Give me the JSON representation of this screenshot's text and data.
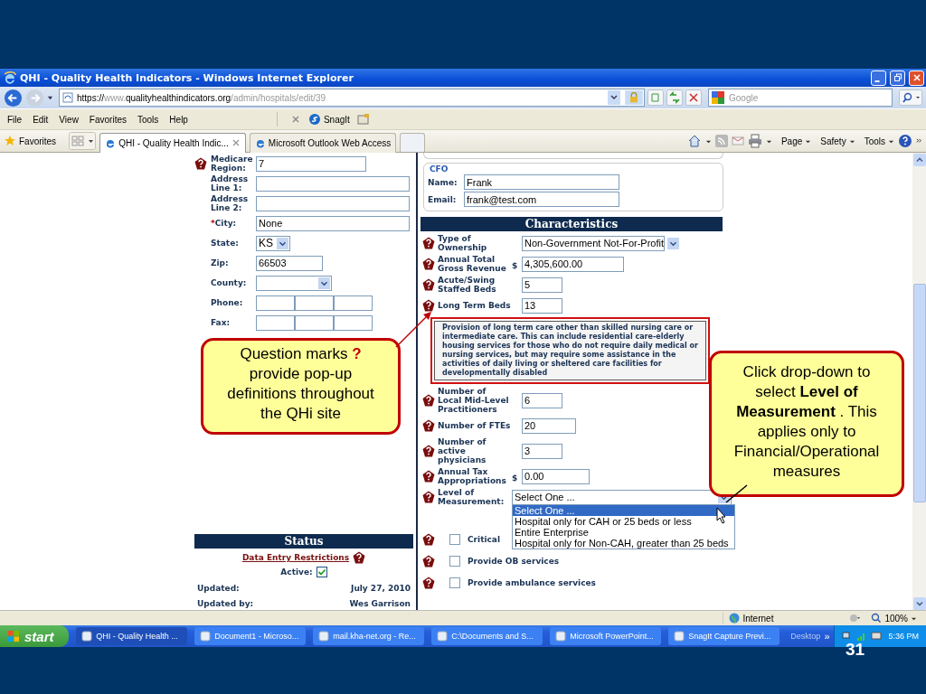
{
  "slide": {
    "number": "31"
  },
  "window": {
    "title": "QHI - Quality Health Indicators - Windows Internet Explorer"
  },
  "address_bar": {
    "url_parts": [
      {
        "text": "https://",
        "dim": false
      },
      {
        "text": "www.",
        "dim": true
      },
      {
        "text": "qualityhealthindicators.org",
        "dim": false
      },
      {
        "text": "/admin/hospitals/edit/39",
        "dim": true
      }
    ]
  },
  "search_field": {
    "placeholder": "Google"
  },
  "menu": [
    "File",
    "Edit",
    "View",
    "Favorites",
    "Tools",
    "Help"
  ],
  "snagit": "SnagIt",
  "favorites": "Favorites",
  "tabs": [
    {
      "label": "QHI - Quality Health Indic...",
      "selected": true
    },
    {
      "label": "Microsoft Outlook Web Access",
      "selected": false
    }
  ],
  "command_bar": [
    "Page",
    "Safety",
    "Tools"
  ],
  "left_form": {
    "rows": [
      {
        "label": "Medicare Region:",
        "help": true,
        "kind": "medium",
        "value": "7"
      },
      {
        "label": "Address Line 1:",
        "kind": "wide"
      },
      {
        "label": "Address Line 2:",
        "kind": "wide"
      },
      {
        "label": "City:",
        "required_mark": "*",
        "kind": "wide",
        "value": "None"
      },
      {
        "label": "State:",
        "kind": "select",
        "value": "KS"
      },
      {
        "label": "Zip:",
        "kind": "short",
        "value": "66503"
      },
      {
        "label": "County:",
        "kind": "combo"
      },
      {
        "label": "Phone:",
        "kind": "split"
      },
      {
        "label": "Fax:",
        "kind": "split"
      }
    ]
  },
  "status": {
    "title": "Status",
    "link": "Data Entry Restrictions",
    "active_label": "Active:",
    "active": true,
    "updated": [
      {
        "label": "Updated:",
        "value": "July 27, 2010"
      },
      {
        "label": "Updated by:",
        "value": "Wes Garrison"
      }
    ]
  },
  "cfo": {
    "legend": "CFO",
    "fields": [
      {
        "label": "Name:",
        "value": "Frank"
      },
      {
        "label": "Email:",
        "value": "frank@test.com"
      }
    ]
  },
  "characteristics": {
    "title": "Characteristics",
    "rows": [
      {
        "label": "Type of Ownership",
        "kind": "select",
        "value": "Non-Government Not-For-Profit"
      },
      {
        "label": "Annual Total Gross Revenue",
        "prefix": "$",
        "kind": "wide",
        "value": "4,305,600.00"
      },
      {
        "label": "Acute/Swing Staffed Beds",
        "kind": "short",
        "value": "5"
      },
      {
        "label": "Long Term Beds",
        "kind": "short",
        "value": "13",
        "tooltip": "Provision of long term care other than skilled nursing care or intermediate care. This can include residential care-elderly housing services for those who do not require daily medical or nursing services, but may require some assistance in the activities of daily living or sheltered care facilities for developmentally disabled"
      },
      {
        "label": "Number of Local Mid-Level Practitioners",
        "kind": "short",
        "value": "6"
      },
      {
        "label": "Number of FTEs",
        "kind": "medium",
        "value": "20"
      },
      {
        "label": "Number of active physicians",
        "kind": "short",
        "value": "3"
      },
      {
        "label": "Annual Tax Appropriations",
        "prefix": "$",
        "kind": "medium-wide",
        "value": "0.00"
      },
      {
        "label": "Level of Measurement:",
        "kind": "open-select",
        "value": "Select One ...",
        "options": [
          {
            "label": "Select One ...",
            "selected": true
          },
          {
            "label": "Hospital only for CAH or 25 beds or less",
            "selected": false
          },
          {
            "label": "Entire Enterprise",
            "selected": false
          },
          {
            "label": "Hospital only for Non-CAH, greater than 25 beds",
            "selected": false
          }
        ]
      }
    ],
    "checks": [
      {
        "label": "Critical",
        "checked": false
      },
      {
        "label": "Provide OB services",
        "checked": false
      },
      {
        "label": "Provide ambulance services",
        "checked": false
      }
    ]
  },
  "status_bar": {
    "zone": "Internet",
    "zoom": "100%"
  },
  "taskbar": {
    "start": "start",
    "items": [
      {
        "label": "QHI - Quality Health ...",
        "selected": true
      },
      {
        "label": "Document1 - Microso...",
        "selected": false
      },
      {
        "label": "mail.kha-net.org - Re...",
        "selected": false
      },
      {
        "label": "C:\\Documents and S...",
        "selected": false
      },
      {
        "label": "Microsoft PowerPoint...",
        "selected": false
      },
      {
        "label": "SnagIt Capture Previ...",
        "selected": false
      }
    ],
    "desktop": "Desktop",
    "chevron": "»",
    "clock": "5:36 PM"
  },
  "callouts": [
    {
      "parts": [
        {
          "kind": "plain",
          "text": "Question marks"
        },
        {
          "kind": "mark",
          "text": "?"
        },
        {
          "kind": "plain",
          "text": "provide pop-up definitions throughout the QHi site"
        }
      ]
    },
    {
      "parts": [
        {
          "kind": "plain",
          "text": "Click drop-down to select **Level of Measurement** . This applies only to Financial/Operational measures"
        }
      ]
    }
  ]
}
